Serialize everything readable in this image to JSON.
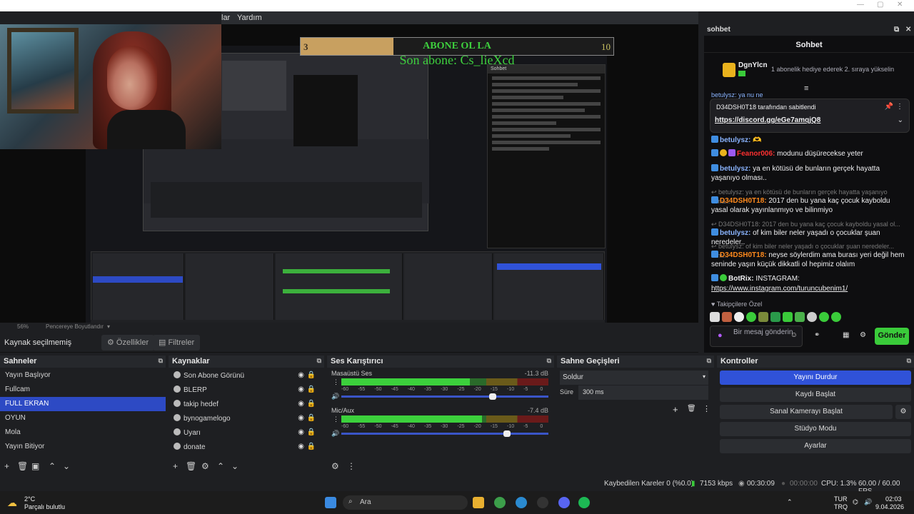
{
  "app": {
    "menu_partial": "lar",
    "menu_help": "Yardım"
  },
  "overlay": {
    "banner_left": "3",
    "banner_title": "ABONE OL LA",
    "banner_right": "10",
    "last_sub": "Son abone: Cs_lieXcd"
  },
  "preview_bar": {
    "zoom": "56%",
    "fit": "Pencereye Boyutlandır"
  },
  "source_bar": {
    "no_source": "Kaynak seçilmemiş",
    "properties": "Özellikler",
    "filters": "Filtreler"
  },
  "chat": {
    "panel_title": "sohbet",
    "header": "Sohbet",
    "gift_user": "DgnYlcn",
    "gift_text": "1 abonelik hediye ederek 2. sıraya yükselin",
    "partial_line": "betulysz: ya nu ne",
    "pinned_by": "D34DSH0T18 tarafından sabitlendi",
    "pinned_link": "https://discord.gg/eGe7amqjQ8",
    "messages": [
      {
        "user": "betulysz:",
        "text": "🫶",
        "color": "#8ab4ff"
      },
      {
        "user": "Feanor006:",
        "text": " modunu düşürecekse yeter",
        "color": "#ff3030"
      },
      {
        "user": "betulysz:",
        "text": " ya en kötüsü de bunların gerçek hayatta yaşanıyo olması..",
        "color": "#8ab4ff"
      },
      {
        "reply": "betulysz: ya en kötüsü de bunların gerçek hayatta yaşanıyo olma..."
      },
      {
        "user": "D34DSH0T18:",
        "text": " 2017 den bu yana kaç çocuk kayboldu yasal olarak yayınlanmıyo ve bilinmiyo",
        "color": "#ff8a1c"
      },
      {
        "reply": "D34DSH0T18: 2017 den bu yana kaç çocuk kayboldu yasal ol..."
      },
      {
        "user": "betulysz:",
        "text": " of kim biler neler yaşadı o çocuklar şuan neredeler..",
        "color": "#8ab4ff"
      },
      {
        "reply": "betulysz: of kim biler neler yaşadı o çocuklar şuan neredeler... isim..."
      },
      {
        "user": "D34DSH0T18:",
        "text": " neyse söylerdim ama burası yeri değil hem seninde yaşın küçük dikkatli ol hepimiz olalım",
        "color": "#ff8a1c"
      },
      {
        "user": "BotRix:",
        "text": " INSTAGRAM:",
        "color": "#efeff1"
      }
    ],
    "instagram": "https://www.instagram.com/turuncubenim1/",
    "followers": "Takipçilere Özel",
    "input_placeholder": "Bir mesaj gönderin",
    "send": "Gönder"
  },
  "scenes": {
    "title": "Sahneler",
    "items": [
      "Yayın Başlıyor",
      "Fullcam",
      "FULL EKRAN",
      "OYUN",
      "Mola",
      "Yayın Bitiyor"
    ],
    "selected": 2
  },
  "sources": {
    "title": "Kaynaklar",
    "items": [
      "Son Abone Görünü",
      "BLERP",
      "takip hedef",
      "bynogamelogo",
      "Uyarı",
      "donate"
    ]
  },
  "mixer": {
    "title": "Ses Karıştırıcı",
    "channels": [
      {
        "name": "Masaüstü Ses",
        "db": "-11.3 dB",
        "level": 0.62,
        "volume": 0.73
      },
      {
        "name": "Mic/Aux",
        "db": "-7.4 dB",
        "level": 0.68,
        "volume": 0.8
      }
    ],
    "scale": [
      "-60",
      "-55",
      "-50",
      "-45",
      "-40",
      "-35",
      "-30",
      "-25",
      "-20",
      "-15",
      "-10",
      "-5",
      "0"
    ]
  },
  "transitions": {
    "title": "Sahne Geçişleri",
    "type": "Soldur",
    "duration_label": "Süre",
    "duration": "300 ms"
  },
  "controls": {
    "title": "Kontroller",
    "items": [
      "Yayını Durdur",
      "Kaydı Başlat",
      "Sanal Kamerayı Başlat",
      "Stüdyo Modu",
      "Ayarlar"
    ]
  },
  "status": {
    "dropped": "Kaybedilen Kareler 0 (%0.0)",
    "bitrate": "7153 kbps",
    "live": "00:30:09",
    "rec": "00:00:00",
    "cpu": "CPU: 1.3%",
    "fps": "60.00 / 60.00 FPS"
  },
  "taskbar": {
    "temp": "2°C",
    "weather": "Parçalı bulutlu",
    "search": "Ara",
    "lang1": "TUR",
    "lang2": "TRQ",
    "time": "02:03",
    "date": "9.04.2026"
  }
}
